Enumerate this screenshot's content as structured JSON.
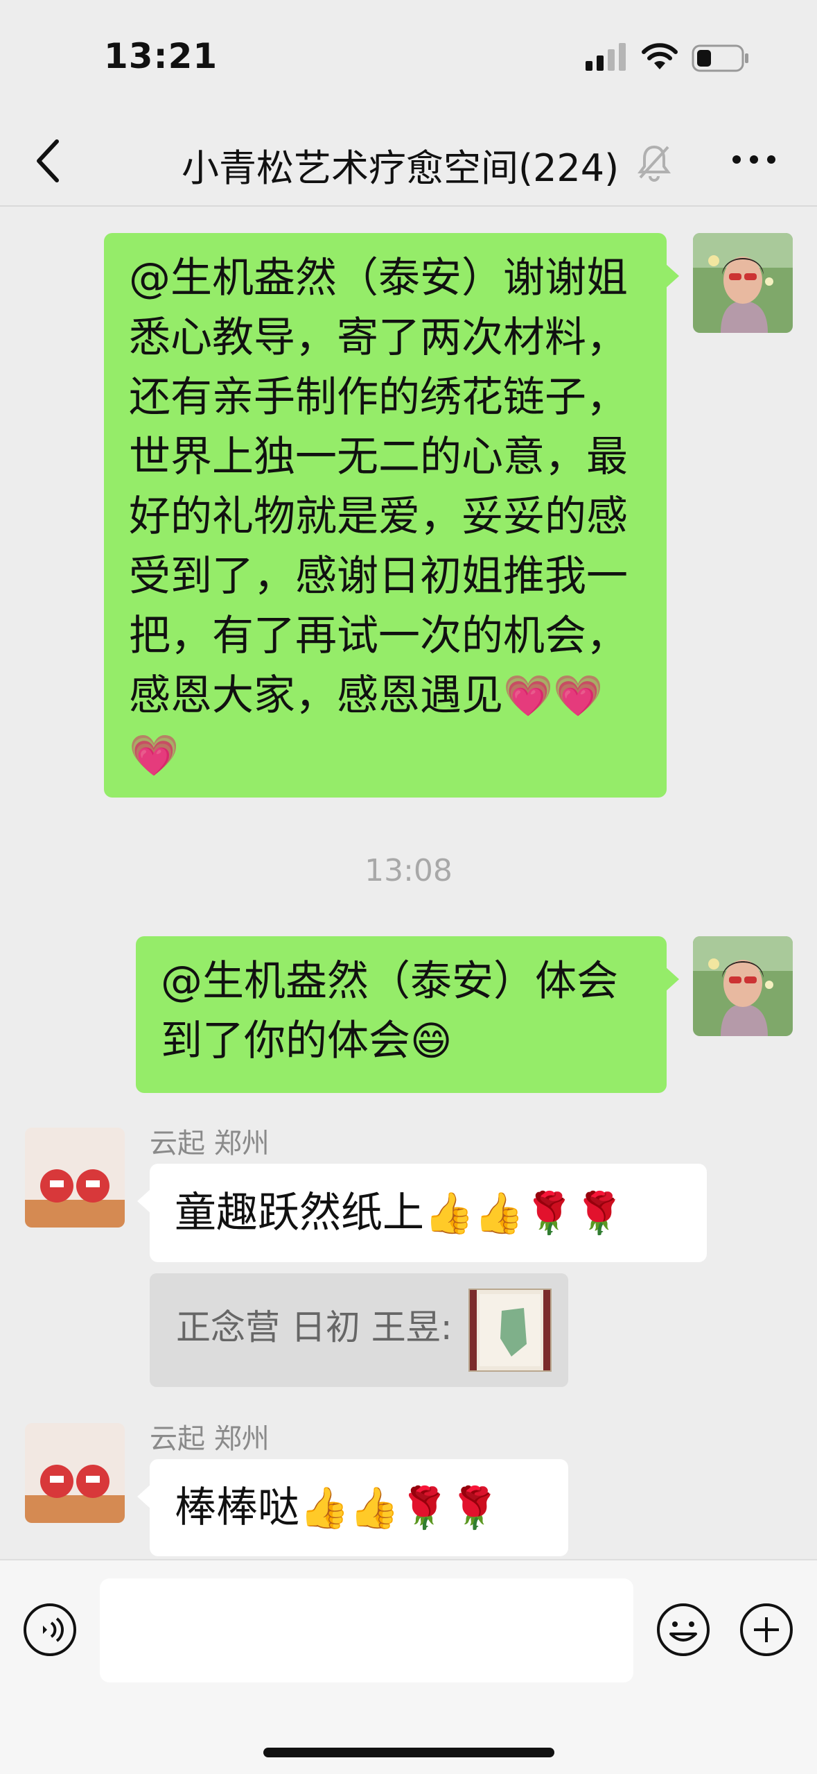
{
  "status": {
    "time": "13:21"
  },
  "header": {
    "title": "小青松艺术疗愈空间(224)"
  },
  "messages": [
    {
      "type": "outgoing",
      "text": "@生机盎然（泰安）谢谢姐 悉心教导，寄了两次材料，还有亲手制作的绣花链子，世界上独一无二的心意，最好的礼物就是爱，妥妥的感受到了，感谢日初姐推我一把，有了再试一次的机会，感恩大家，感恩遇见",
      "emoji": "💗💗💗"
    },
    {
      "type": "timestamp",
      "text": "13:08"
    },
    {
      "type": "outgoing",
      "text": "@生机盎然（泰安）体会到了你的体会",
      "emoji": "😄"
    },
    {
      "type": "incoming",
      "sender": "云起  郑州",
      "text": "童趣跃然纸上",
      "emoji": "👍👍🌹🌹"
    },
    {
      "type": "quote",
      "text": "正念营 日初 王昱:"
    },
    {
      "type": "incoming",
      "sender": "云起  郑州",
      "text": "棒棒哒",
      "emoji": "👍👍🌹🌹"
    }
  ],
  "icons": [
    "back-icon",
    "mute-icon",
    "more-icon",
    "voice-icon",
    "emoji-icon",
    "plus-icon"
  ],
  "colors": {
    "outgoing_bubble": "#95ec69",
    "background": "#ededed"
  }
}
